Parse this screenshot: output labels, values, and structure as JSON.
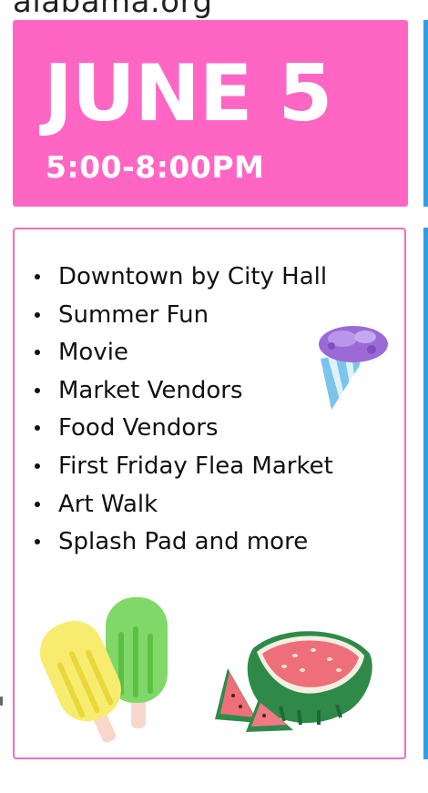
{
  "page": {
    "url_fragment": "alabama.org"
  },
  "date_card": {
    "date": "JUNE 5",
    "time": "5:00-8:00PM",
    "background_color": "#ff66c4"
  },
  "info_card": {
    "border_color": "#ee6fc0",
    "items": [
      "Downtown by City Hall",
      "Summer Fun",
      "Movie",
      "Market Vendors",
      "Food Vendors",
      "First Friday Flea Market",
      "Art Walk",
      "Splash Pad and more"
    ]
  },
  "illustrations": [
    "snow-cone-icon",
    "popsicles-icon",
    "watermelon-icon"
  ]
}
